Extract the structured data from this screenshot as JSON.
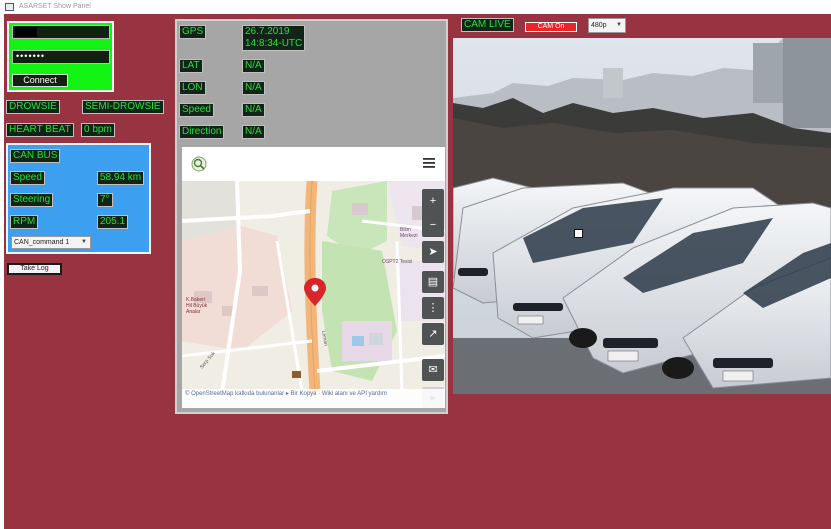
{
  "window": {
    "title": "ASARSET Show Panel"
  },
  "login": {
    "username_value": "",
    "password_value": "•••••••",
    "connect_label": "Connect"
  },
  "status": {
    "drowsiness_label": "DROWSIE",
    "semi_drowsiness_label": "SEMI-DROWSIE",
    "heart_beat_label": "HEART BEAT",
    "heart_beat_value": "0 bpm"
  },
  "can_bus": {
    "title": "CAN BUS",
    "speed_label": "Speed",
    "speed_value": "58.94 km",
    "steering_label": "Steering",
    "steering_value": "7°",
    "rpm_label": "RPM",
    "rpm_value": "205.1",
    "command_selected": "CAN_command 1"
  },
  "take_log_label": "Take Log",
  "gps": {
    "label": "GPS",
    "date": "26.7.2019",
    "time": "14:8:34-UTC",
    "lat_label": "LAT",
    "lat_value": "N/A",
    "lon_label": "LON",
    "lon_value": "N/A",
    "speed_label": "Speed",
    "speed_value": "N/A",
    "direction_label": "Direction",
    "direction_value": "N/A"
  },
  "map": {
    "attribution": "© OpenStreetMap katkıda bulunanlar ▸ Bir Kopya · Wiki alanı ve API yardım",
    "labels": {
      "area_left": "K.Bakeri\nHil Büyük\nAnalar",
      "road": "Leman",
      "poi": "OSPT2 Tesisi",
      "street_bottom": "Serp Sok",
      "poi_top": "Bilim\nMerkezi"
    },
    "controls": [
      "+",
      "−",
      "➤",
      "▤",
      "⋮",
      "↗",
      "✉",
      "▸"
    ]
  },
  "camera": {
    "live_label": "CAM LIVE",
    "toggle_label": "CAM On",
    "resolution_selected": "480p"
  },
  "colors": {
    "background": "#983342",
    "login_panel": "#13f313",
    "can_panel": "#3d9ff0",
    "gps_panel": "#a6a6a6",
    "label_text": "#25e13a"
  }
}
